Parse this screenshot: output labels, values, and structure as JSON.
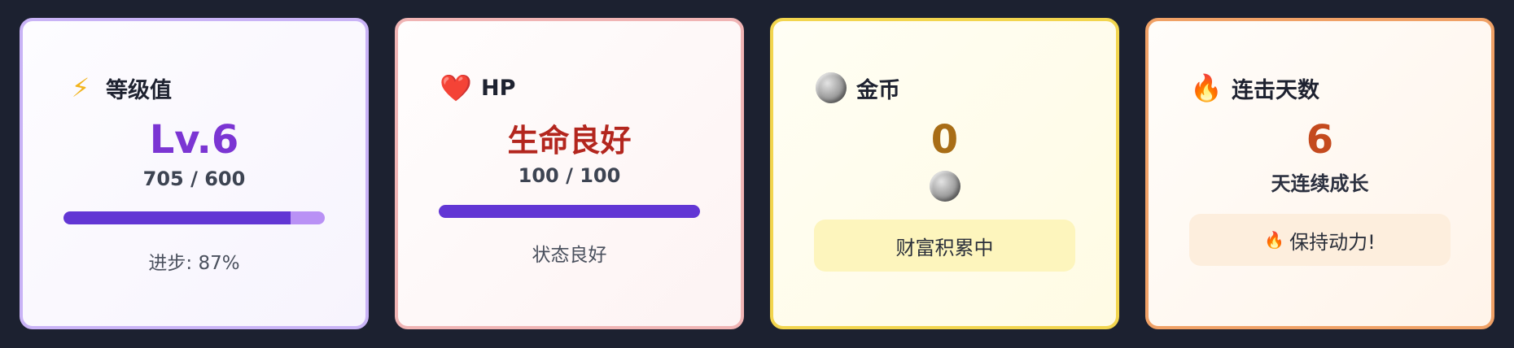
{
  "cards": {
    "level": {
      "icon": "⚡",
      "icon_name": "lightning-icon",
      "title": "等级值",
      "value": "Lv.6",
      "sub": "705 / 600",
      "progress": 0.87,
      "note": "进步: 87%",
      "accent": "#7b35d3"
    },
    "hp": {
      "icon": "❤️",
      "icon_name": "heart-icon",
      "title": "HP",
      "value": "生命良好",
      "sub": "100 / 100",
      "progress": 1.0,
      "note": "状态良好",
      "accent": "#b3261e"
    },
    "coins": {
      "icon_name": "moon-coin-icon",
      "title": "金币",
      "value": "0",
      "pill": "财富积累中",
      "accent": "#a86d16"
    },
    "streak": {
      "icon": "🔥",
      "icon_name": "fire-icon",
      "title": "连击天数",
      "value": "6",
      "sub": "天连续成长",
      "pill_icon": "🔥",
      "pill": "保持动力!",
      "accent": "#c44a1e"
    }
  }
}
